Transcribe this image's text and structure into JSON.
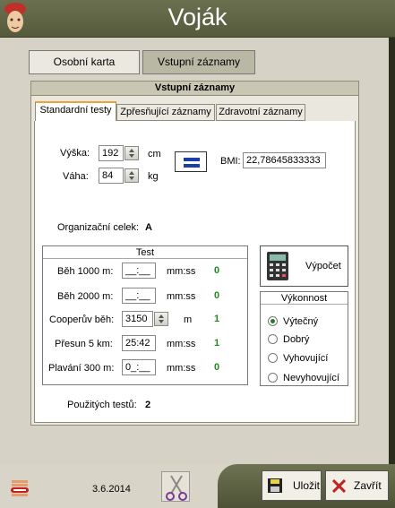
{
  "window": {
    "title": "Voják"
  },
  "nav": {
    "tab1": "Osobní karta",
    "tab2": "Vstupní záznamy"
  },
  "section": {
    "title": "Vstupní záznamy"
  },
  "tabs": [
    "Standardní testy",
    "Zpřesňující záznamy",
    "Zdravotní záznamy"
  ],
  "body": {
    "height_label": "Výška:",
    "height_value": "192",
    "height_unit": "cm",
    "weight_label": "Váha:",
    "weight_value": "84",
    "weight_unit": "kg",
    "bmi_label": "BMI:",
    "bmi_value": "22,78645833333",
    "org_label": "Organizační celek:",
    "org_value": "A"
  },
  "test": {
    "title": "Test",
    "rows": [
      {
        "label": "Běh 1000 m:",
        "value": "__:__",
        "unit": "mm:ss",
        "score": "0"
      },
      {
        "label": "Běh 2000 m:",
        "value": "__:__",
        "unit": "mm:ss",
        "score": "0"
      },
      {
        "label": "Cooperův běh:",
        "value": "3150",
        "unit": "m",
        "score": "1"
      },
      {
        "label": "Přesun 5 km:",
        "value": "25:42",
        "unit": "mm:ss",
        "score": "1"
      },
      {
        "label": "Plavání 300 m:",
        "value": "0_:__",
        "unit": "mm:ss",
        "score": "0"
      }
    ]
  },
  "calc": {
    "label": "Výpočet"
  },
  "performance": {
    "title": "Výkonnost",
    "options": [
      "Výtečný",
      "Dobrý",
      "Vyhovující",
      "Nevyhovující"
    ],
    "selected_index": 0
  },
  "used": {
    "label": "Použitých testů:",
    "value": "2"
  },
  "footer": {
    "date": "3.6.2014",
    "save": "Uložit",
    "close": "Zavřít"
  },
  "icons": {
    "face": "soldier-face-icon",
    "calc": "calculator-icon",
    "save": "floppy-disk-icon",
    "close": "red-x-icon",
    "scissors": "scissors-icon",
    "stack": "document-stack-icon"
  }
}
